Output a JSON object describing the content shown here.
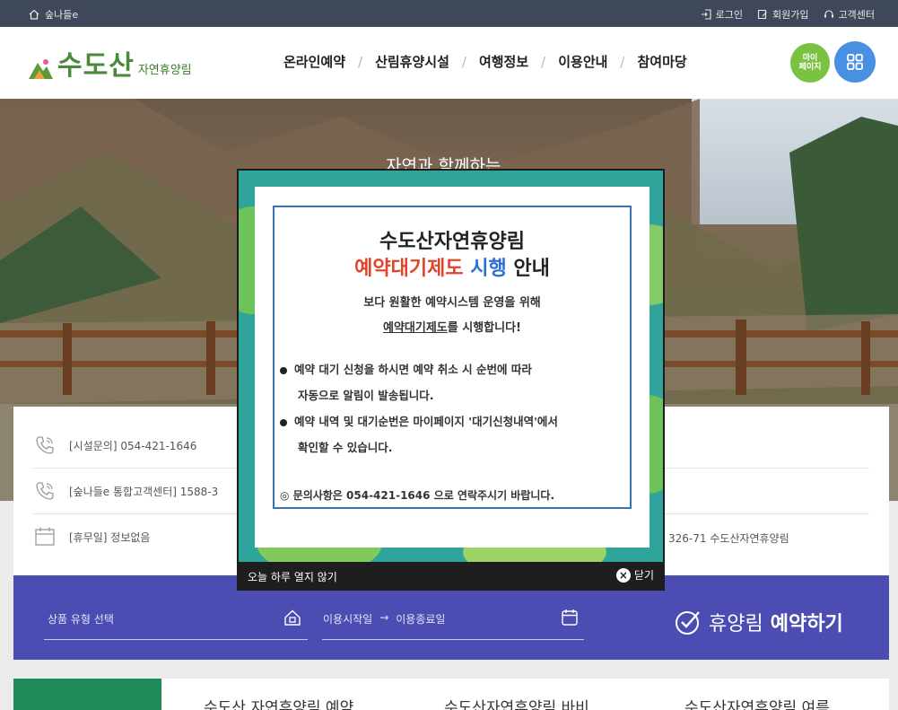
{
  "topbar": {
    "site_name": "숲나들e",
    "login": "로그인",
    "signup": "회원가입",
    "support": "고객센터"
  },
  "header": {
    "logo_main": "수도산",
    "logo_sub": "자연휴양림",
    "nav": [
      "온라인예약",
      "산림휴양시설",
      "여행정보",
      "이용안내",
      "참여마당"
    ],
    "mypage_line1": "마이",
    "mypage_line2": "페이지"
  },
  "hero": {
    "tagline": "자연과 함께하는"
  },
  "info": {
    "facility_phone": "[시설문의] 054-421-1646",
    "call_center": "[숲나들e 통합고객센터] 1588-3",
    "holiday": "[휴무일] 정보없음",
    "address_partial": "326-71 수도산자연휴양림"
  },
  "reserve": {
    "product_type": "상품 유형 선택",
    "date_start": "이용시작일",
    "arrow": "→",
    "date_end": "이용종료일",
    "btn_prefix": "휴양림",
    "btn_main": "예약하기"
  },
  "bottom": {
    "t1": "수도산 자연휴양림 예약",
    "t2": "수도산자연휴양림 바비",
    "t3": "수도산자연휴양림 여름"
  },
  "popup": {
    "title": "수도산자연휴양림",
    "subtitle_red": "예약대기제도",
    "subtitle_blue": "시행",
    "subtitle_rest": "안내",
    "lead1": "보다 원활한 예약시스템 운영을 위해",
    "lead2_underlined": "예약대기제도",
    "lead2_rest": "를 시행합니다!",
    "bullet1_line1": "예약 대기 신청을 하시면 예약 취소 시 순번에 따라",
    "bullet1_line2": "자동으로 알림이 발송됩니다.",
    "bullet2_line1": "예약 내역 및 대기순번은 마이페이지 '대기신청내역'에서",
    "bullet2_line2": "확인할 수 있습니다.",
    "contact": "◎ 문의사항은 054-421-1646 으로 연락주시기 바랍니다.",
    "dont_show_today": "오늘 하루 열지 않기",
    "close": "닫기"
  },
  "colors": {
    "topbar": "#3e4858",
    "reserve_band": "#4b4db3",
    "popup_teal": "#2fa49a",
    "popup_border": "#3a72b8",
    "accent_red": "#e0452b",
    "accent_blue": "#2b6fd6"
  }
}
